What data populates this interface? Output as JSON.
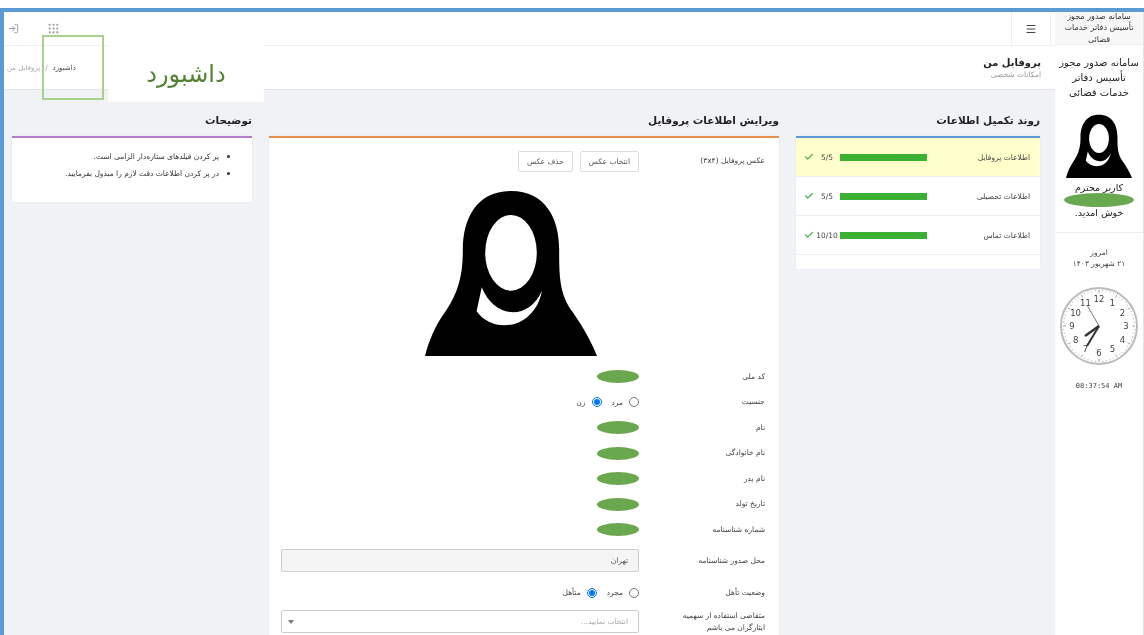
{
  "sidebar": {
    "system_title": "سامانه صدور مجوز تأسیس دفاتر خدمات قضائی",
    "title": "سامانه صدور مجوز تأسیس دفاتر خدمات قضائی",
    "greeting": "کاربر محترم",
    "user_name_redacted": true,
    "welcome": "خوش امدید.",
    "date_label": "امروز",
    "date": "۲۱ شهریور ۱۴۰۳",
    "clock": {
      "numerals": [
        "12",
        "1",
        "11",
        "2",
        "10",
        "3",
        "9",
        "4",
        "8",
        "5",
        "7",
        "6"
      ],
      "time": "08:37:54 AM"
    }
  },
  "page_header": {
    "title": "پروفایل من",
    "subtitle": "امکانات شخصی",
    "separator": "/",
    "breadcrumb": [
      {
        "label": "داشبورد",
        "selected": false
      },
      {
        "label": "پروفایل من",
        "selected": true
      }
    ]
  },
  "annotation": {
    "label": "داشبورد"
  },
  "progress": {
    "title": "روند تکمیل اطلاعات",
    "rows": [
      {
        "label": "اطلاعات پروفایل",
        "level": 1,
        "reading": "5/5",
        "selected": true,
        "complete": true
      },
      {
        "label": "اطلاعات تحصیلی",
        "level": 1,
        "reading": "5/5",
        "selected": false,
        "complete": true
      },
      {
        "label": "اطلاعات تماس",
        "level": 1,
        "reading": "10/10",
        "selected": false,
        "complete": true
      }
    ]
  },
  "profile_form": {
    "title": "ویرایش اطلاعات پروفایل",
    "photo_label": "عکس پروفایل (۳x۴)",
    "buttons": [
      "انتخاب عکس",
      "حذف عکس"
    ],
    "fields": [
      {
        "label": "کد ملی",
        "kind": "redacted"
      },
      {
        "label": "جنسیت",
        "kind": "radio",
        "options": [
          {
            "label": "مرد",
            "selected": false
          },
          {
            "label": "زن",
            "selected": true
          }
        ]
      },
      {
        "label": "نام",
        "kind": "redacted"
      },
      {
        "label": "نام خانوادگی",
        "kind": "redacted"
      },
      {
        "label": "نام پدر",
        "kind": "redacted"
      },
      {
        "label": "تاریخ تولد",
        "kind": "redacted"
      },
      {
        "label": "شماره شناسنامه",
        "kind": "redacted"
      },
      {
        "label": "محل صدور شناسنامه",
        "kind": "input",
        "value": "تهران"
      },
      {
        "label": "وضعیت تأهل",
        "kind": "radio",
        "options": [
          {
            "label": "مجرد",
            "selected": false
          },
          {
            "label": "متأهل",
            "selected": true
          }
        ]
      },
      {
        "label": "متقاضی استفاده از سهمیه ایثارگران می باشم",
        "kind": "select",
        "placeholder": "انتخاب نمایید..."
      }
    ]
  },
  "notes": {
    "title": "توضیحات",
    "items": [
      "پر کردن فیلدهای ستاره‌دار الزامی است.",
      "در پر کردن اطلاعات دقت لازم را مبذول بفرمایید."
    ]
  }
}
